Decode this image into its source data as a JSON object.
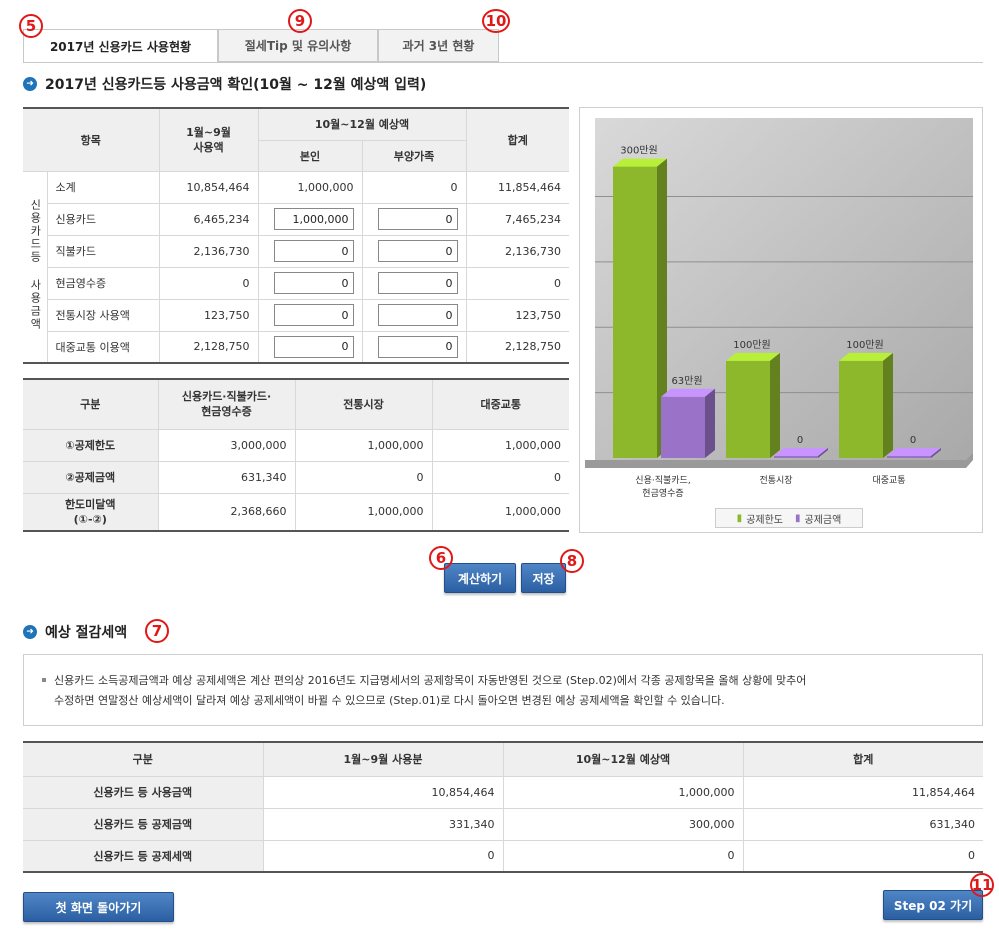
{
  "tabs": [
    {
      "label": "2017년 신용카드 사용현황",
      "active": true
    },
    {
      "label": "절세Tip 및 유의사항",
      "active": false
    },
    {
      "label": "과거 3년 현황",
      "active": false
    }
  ],
  "markers": [
    "5",
    "9",
    "10",
    "6",
    "8",
    "7",
    "11"
  ],
  "section1": {
    "title": "2017년 신용카드등 사용금액 확인(10월 ~ 12월 예상액 입력)"
  },
  "usage_table": {
    "headers": {
      "item": "항목",
      "jan_sep": "1월~9월\n사용액",
      "oct_dec": "10월~12월 예상액",
      "self": "본인",
      "dependents": "부양가족",
      "total": "합계"
    },
    "group_label": "신용카드등 사용금액",
    "rows": [
      {
        "label": "소계",
        "jan_sep": "10,854,464",
        "self": "1,000,000",
        "dep": "0",
        "total": "11,854,464"
      },
      {
        "label": "신용카드",
        "jan_sep": "6,465,234",
        "self": "1,000,000",
        "dep": "0",
        "total": "7,465,234"
      },
      {
        "label": "직불카드",
        "jan_sep": "2,136,730",
        "self": "0",
        "dep": "0",
        "total": "2,136,730"
      },
      {
        "label": "현금영수증",
        "jan_sep": "0",
        "self": "0",
        "dep": "0",
        "total": "0"
      },
      {
        "label": "전통시장 사용액",
        "jan_sep": "123,750",
        "self": "0",
        "dep": "0",
        "total": "123,750"
      },
      {
        "label": "대중교통 이용액",
        "jan_sep": "2,128,750",
        "self": "0",
        "dep": "0",
        "total": "2,128,750"
      }
    ]
  },
  "deduct_table": {
    "headers": {
      "category": "구분",
      "card": "신용카드·직불카드·\n현금영수증",
      "market": "전통시장",
      "transit": "대중교통"
    },
    "rows": [
      {
        "label": "①공제한도",
        "card": "3,000,000",
        "market": "1,000,000",
        "transit": "1,000,000"
      },
      {
        "label": "②공제금액",
        "card": "631,340",
        "market": "0",
        "transit": "0"
      },
      {
        "label": "한도미달액\n(①-②)",
        "card": "2,368,660",
        "market": "1,000,000",
        "transit": "1,000,000"
      }
    ]
  },
  "buttons": {
    "calc": "계산하기",
    "save": "저장",
    "home": "첫 화면 돌아가기",
    "next": "Step 02 가기"
  },
  "section2": {
    "title": "예상 절감세액"
  },
  "notice": {
    "line1": "신용카드 소득공제금액과 예상 공제세액은 계산 편의상 2016년도 지급명세서의 공제항목이 자동반영된 것으로 (Step.02)에서 각종 공제항목을 올해 상황에 맞추어",
    "line2": "수정하면 연말정산 예상세액이 달라져 예상 공제세액이 바뀔 수 있으므로 (Step.01)로 다시 돌아오면 변경된 예상 공제세액을 확인할 수 있습니다."
  },
  "summary_table": {
    "headers": {
      "category": "구분",
      "jan_sep": "1월~9월 사용분",
      "oct_dec": "10월~12월 예상액",
      "total": "합계"
    },
    "rows": [
      {
        "label": "신용카드 등 사용금액",
        "jan_sep": "10,854,464",
        "oct_dec": "1,000,000",
        "total": "11,854,464"
      },
      {
        "label": "신용카드 등 공제금액",
        "jan_sep": "331,340",
        "oct_dec": "300,000",
        "total": "631,340"
      },
      {
        "label": "신용카드 등 공제세액",
        "jan_sep": "0",
        "oct_dec": "0",
        "total": "0"
      }
    ]
  },
  "chart_data": {
    "type": "bar",
    "categories": [
      "신용·직불카드,\n현금영수증",
      "전통시장",
      "대중교통"
    ],
    "series": [
      {
        "name": "공제한도",
        "values": [
          300,
          100,
          100
        ],
        "labels": [
          "300만원",
          "100만원",
          "100만원"
        ],
        "color": "#8db82c"
      },
      {
        "name": "공제금액",
        "values": [
          63,
          0,
          0
        ],
        "labels": [
          "63만원",
          "0",
          "0"
        ],
        "color": "#9a72c8"
      }
    ],
    "ylim": [
      0,
      350
    ],
    "grid": true,
    "legend": "bottom"
  }
}
